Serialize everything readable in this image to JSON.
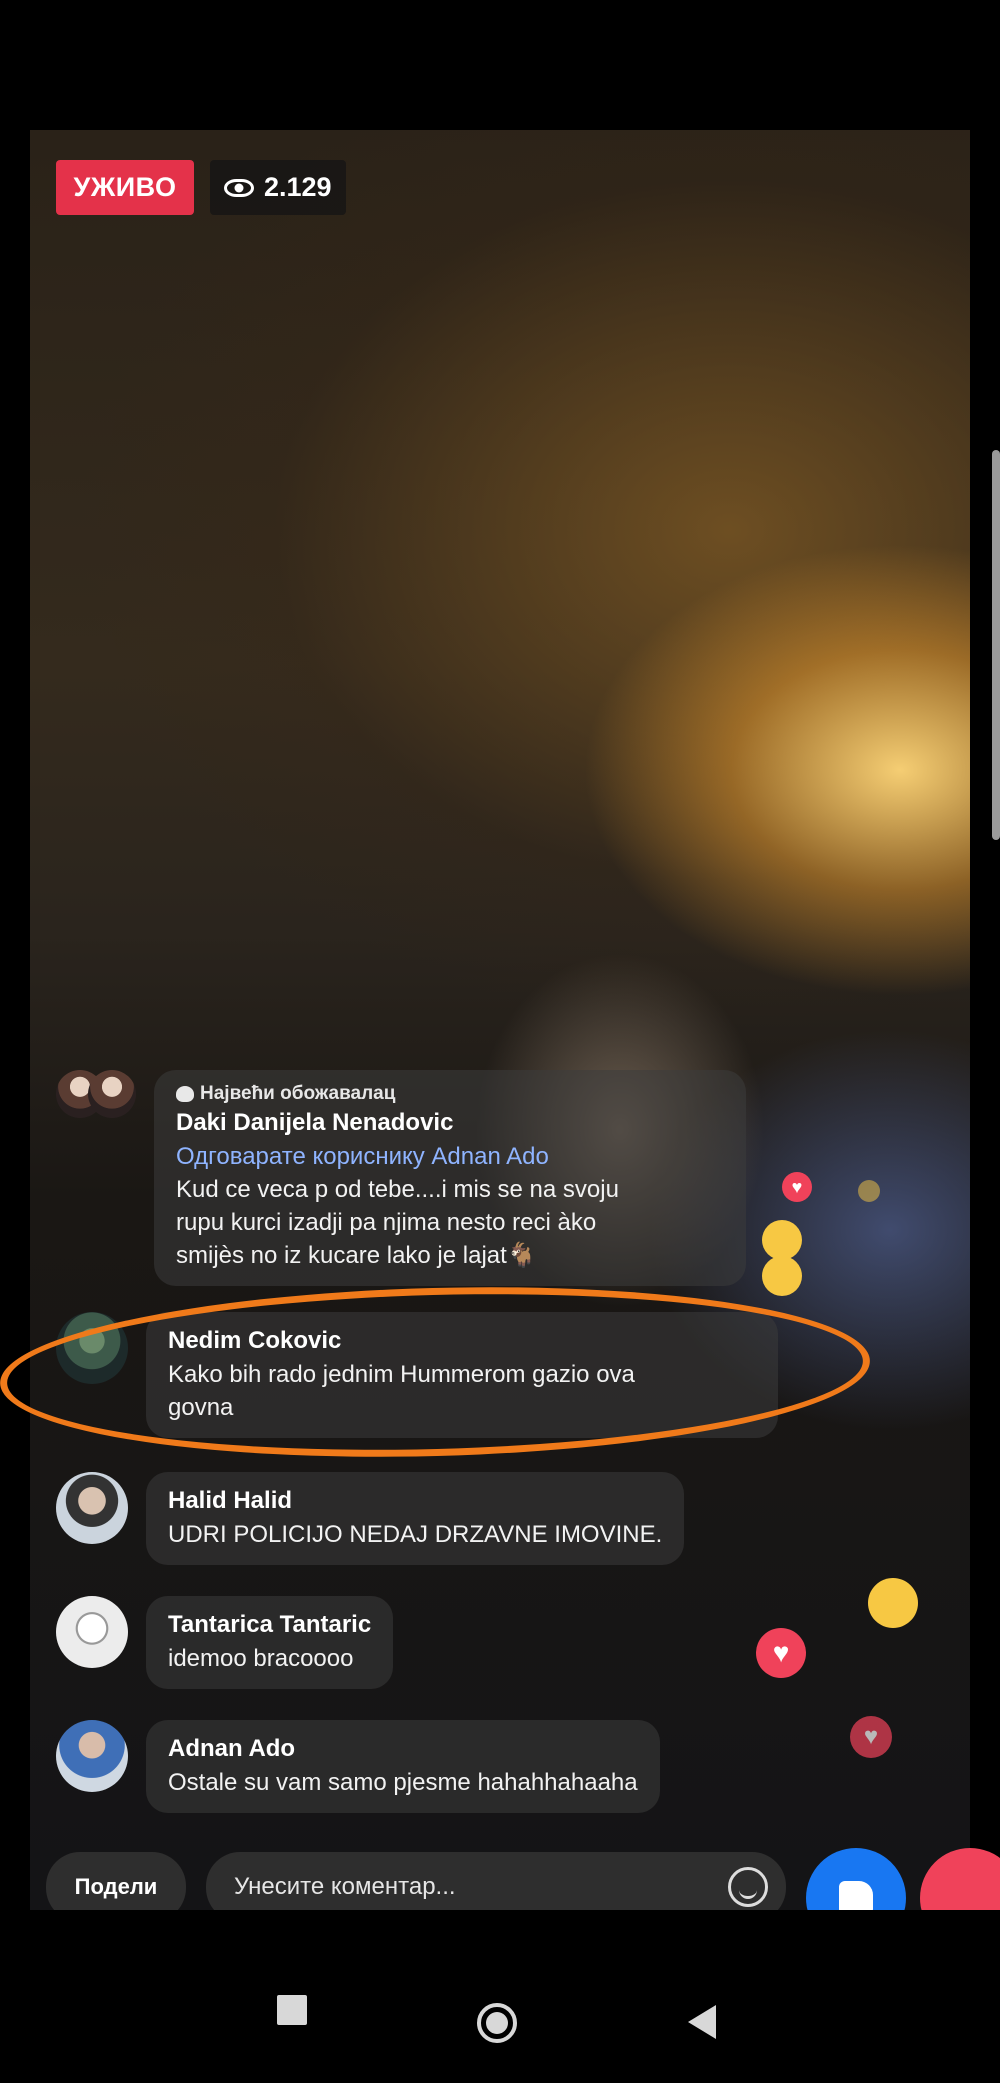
{
  "live": {
    "badge_label": "УЖИВО",
    "viewer_count": "2.129"
  },
  "comments": [
    {
      "badge": "Највећи обожавалац",
      "name": "Daki Danijela Nenadovic",
      "reply_to": "Одговарате кориснику Adnan Ado",
      "lines": [
        "Kud ce veca p od tebe....i mis se na svoju",
        "rupu kurci izadji pa njima nesto reci àko",
        "smijès no iz kucare lako je lajat🐐"
      ]
    },
    {
      "name": "Nedim Cokovic",
      "lines": [
        "Kako bih rado jednim Hummerom gazio ova",
        "govna"
      ]
    },
    {
      "name": "Halid Halid",
      "lines": [
        "UDRI POLICIJO NEDAJ DRZAVNE IMOVINE."
      ]
    },
    {
      "name": "Tantarica Tantaric",
      "lines": [
        "idemoo bracoooo"
      ]
    },
    {
      "name": "Adnan Ado",
      "lines": [
        "Ostale su vam samo pjesme hahahhahaaha"
      ]
    }
  ],
  "bottom_bar": {
    "share_label": "Подели",
    "comment_placeholder": "Унесите коментар..."
  },
  "colors": {
    "live_badge": "#e4324a",
    "highlight_ring": "#f07a1a",
    "reply_link": "#8fb4ff",
    "like_button": "#1877f2",
    "love_button": "#f0425a"
  }
}
